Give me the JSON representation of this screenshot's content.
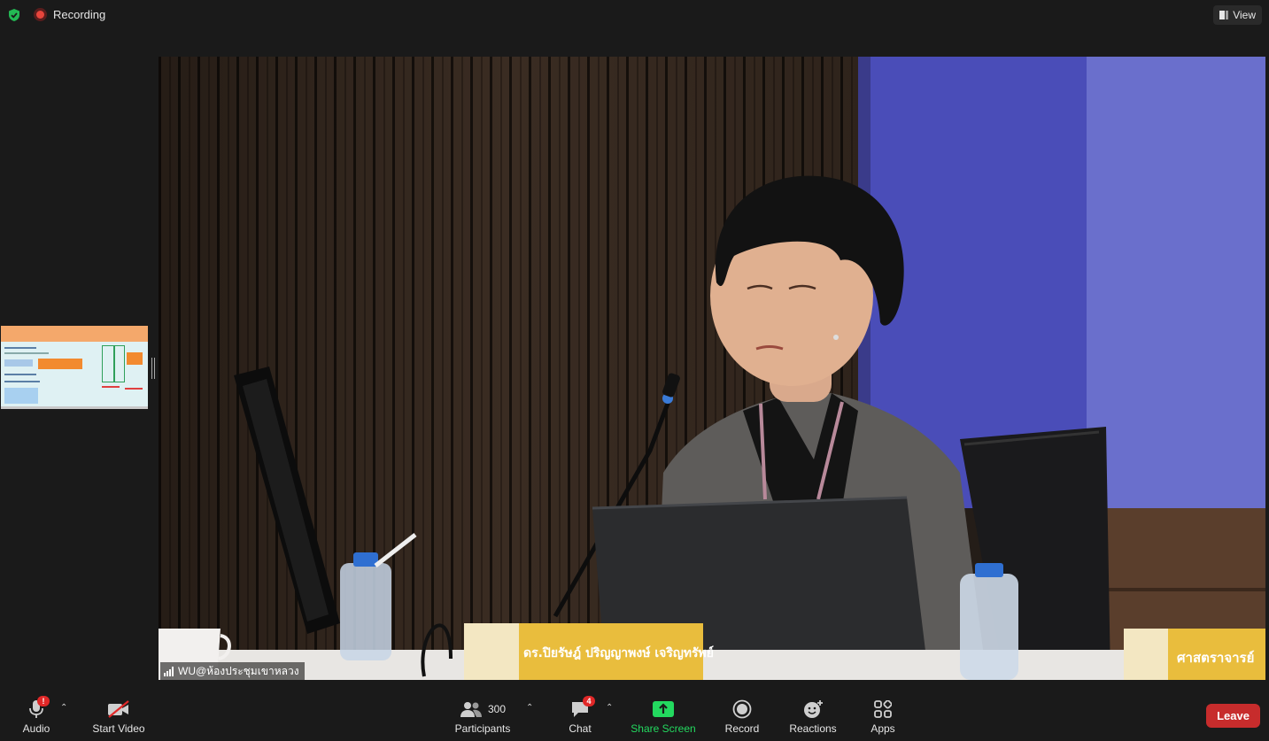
{
  "top_bar": {
    "security_icon": "shield-check-icon",
    "recording_label": "Recording",
    "view_label": "View"
  },
  "main_video": {
    "participant_name": "WU@ห้องประชุมเขาหลวง",
    "nameplate_text": "ดร.ปิยรัษฎ์ ปริญญาพงษ์ เจริญทรัพย์",
    "nameplate_right_text": "ศาสตราจารย์"
  },
  "toolbar": {
    "audio": {
      "label": "Audio",
      "badge": "!"
    },
    "video": {
      "label": "Start Video"
    },
    "participants": {
      "label": "Participants",
      "count": "300"
    },
    "chat": {
      "label": "Chat",
      "badge": "4"
    },
    "share": {
      "label": "Share Screen"
    },
    "record": {
      "label": "Record"
    },
    "reactions": {
      "label": "Reactions"
    },
    "apps": {
      "label": "Apps"
    },
    "leave": {
      "label": "Leave"
    }
  },
  "colors": {
    "accent_green": "#23d95f",
    "leave_red": "#c72c2c",
    "badge_red": "#e02828",
    "background": "#1a1a1a"
  }
}
